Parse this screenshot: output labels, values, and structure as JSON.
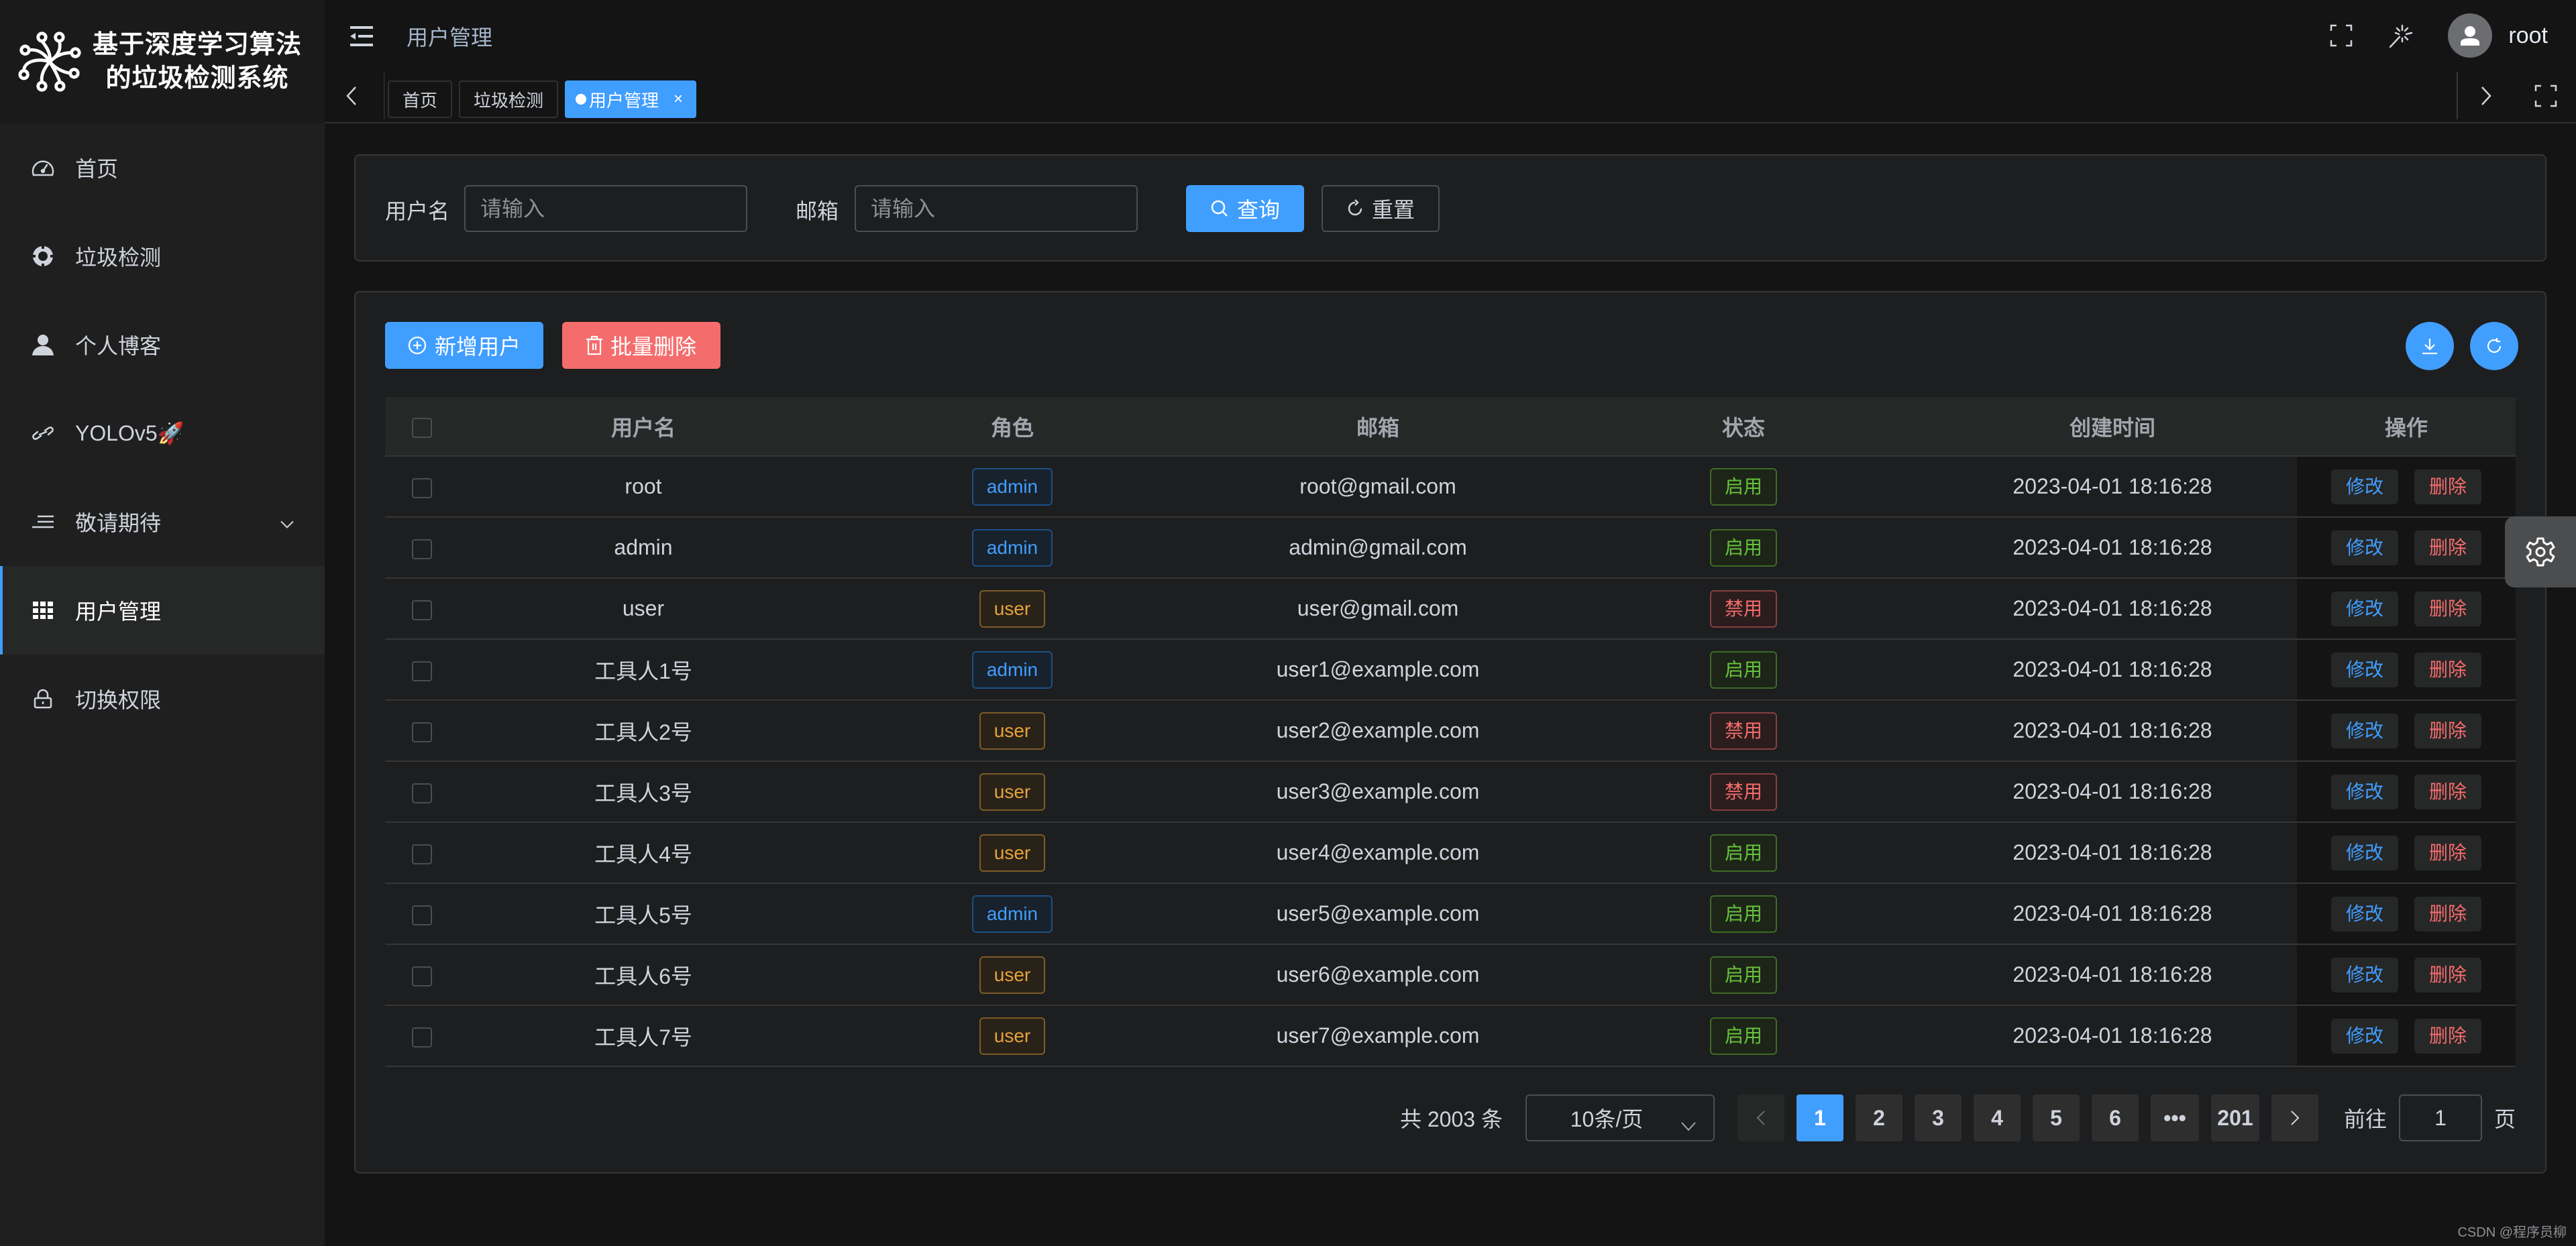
{
  "app": {
    "title_line1": "基于深度学习算法",
    "title_line2": "的垃圾检测系统"
  },
  "sidebar": {
    "items": [
      {
        "label": "首页",
        "icon": "dashboard-icon"
      },
      {
        "label": "垃圾检测",
        "icon": "aim-icon"
      },
      {
        "label": "个人博客",
        "icon": "user-icon"
      },
      {
        "label": "YOLOv5🚀",
        "icon": "link-icon"
      },
      {
        "label": "敬请期待",
        "icon": "list-icon",
        "expandable": true
      },
      {
        "label": "用户管理",
        "icon": "grid-icon",
        "active": true
      },
      {
        "label": "切换权限",
        "icon": "lock-icon"
      }
    ]
  },
  "header": {
    "page_title": "用户管理",
    "username": "root"
  },
  "tags": [
    {
      "label": "首页"
    },
    {
      "label": "垃圾检测"
    },
    {
      "label": "用户管理",
      "active": true,
      "closable": true,
      "close_glyph": "×"
    }
  ],
  "search": {
    "username_label": "用户名",
    "username_placeholder": "请输入",
    "username_value": "",
    "email_label": "邮箱",
    "email_placeholder": "请输入",
    "email_value": "",
    "query_label": "查询",
    "reset_label": "重置"
  },
  "toolbar": {
    "add_label": "新增用户",
    "batch_delete_label": "批量删除"
  },
  "table": {
    "columns": [
      "用户名",
      "角色",
      "邮箱",
      "状态",
      "创建时间",
      "操作"
    ],
    "edit_label": "修改",
    "delete_label": "删除",
    "rows": [
      {
        "username": "root",
        "role": "admin",
        "email": "root@gmail.com",
        "status": "启用",
        "created": "2023-04-01 18:16:28"
      },
      {
        "username": "admin",
        "role": "admin",
        "email": "admin@gmail.com",
        "status": "启用",
        "created": "2023-04-01 18:16:28"
      },
      {
        "username": "user",
        "role": "user",
        "email": "user@gmail.com",
        "status": "禁用",
        "created": "2023-04-01 18:16:28"
      },
      {
        "username": "工具人1号",
        "role": "admin",
        "email": "user1@example.com",
        "status": "启用",
        "created": "2023-04-01 18:16:28"
      },
      {
        "username": "工具人2号",
        "role": "user",
        "email": "user2@example.com",
        "status": "禁用",
        "created": "2023-04-01 18:16:28"
      },
      {
        "username": "工具人3号",
        "role": "user",
        "email": "user3@example.com",
        "status": "禁用",
        "created": "2023-04-01 18:16:28"
      },
      {
        "username": "工具人4号",
        "role": "user",
        "email": "user4@example.com",
        "status": "启用",
        "created": "2023-04-01 18:16:28"
      },
      {
        "username": "工具人5号",
        "role": "admin",
        "email": "user5@example.com",
        "status": "启用",
        "created": "2023-04-01 18:16:28"
      },
      {
        "username": "工具人6号",
        "role": "user",
        "email": "user6@example.com",
        "status": "启用",
        "created": "2023-04-01 18:16:28"
      },
      {
        "username": "工具人7号",
        "role": "user",
        "email": "user7@example.com",
        "status": "启用",
        "created": "2023-04-01 18:16:28"
      }
    ]
  },
  "pagination": {
    "total_text": "共 2003 条",
    "page_size": "10条/页",
    "pages": [
      "1",
      "2",
      "3",
      "4",
      "5",
      "6",
      "•••",
      "201"
    ],
    "current_page": "1",
    "goto_label": "前往",
    "goto_value": "1",
    "page_suffix": "页"
  },
  "colors": {
    "primary": "#409eff",
    "danger": "#f56c6c",
    "success": "#67c23a",
    "warning": "#e6a23c"
  },
  "watermark": "CSDN @程序员柳"
}
